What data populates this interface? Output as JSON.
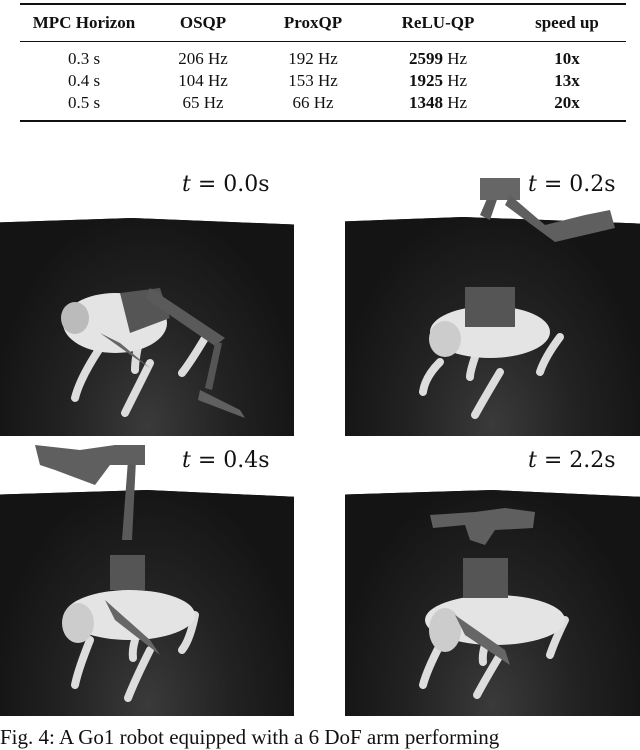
{
  "table": {
    "headers": [
      "MPC Horizon",
      "OSQP",
      "ProxQP",
      "ReLU-QP",
      "speed up"
    ],
    "rows": [
      {
        "horizon": "0.3 s",
        "osqp": "206 Hz",
        "proxqp": "192 Hz",
        "reluqp_value": "2599",
        "reluqp_unit": " Hz",
        "speedup": "10x"
      },
      {
        "horizon": "0.4 s",
        "osqp": "104 Hz",
        "proxqp": "153 Hz",
        "reluqp_value": "1925",
        "reluqp_unit": " Hz",
        "speedup": "13x"
      },
      {
        "horizon": "0.5 s",
        "osqp": "65 Hz",
        "proxqp": "66 Hz",
        "reluqp_value": "1348",
        "reluqp_unit": " Hz",
        "speedup": "20x"
      }
    ]
  },
  "panels": [
    {
      "t_var": "t",
      "eq": " = ",
      "t_value": "0.0s",
      "image": "Go1 robot with arm reaching down to ground"
    },
    {
      "t_var": "t",
      "eq": " = ",
      "t_value": "0.2s",
      "image": "Go1 robot with arm swinging upward"
    },
    {
      "t_var": "t",
      "eq": " = ",
      "t_value": "0.4s",
      "image": "Go1 robot with arm extended up and sideways"
    },
    {
      "t_var": "t",
      "eq": " = ",
      "t_value": "2.2s",
      "image": "Go1 robot with arm folded above body"
    }
  ],
  "caption": "Fig. 4: A Go1 robot equipped with a 6 DoF arm performing"
}
